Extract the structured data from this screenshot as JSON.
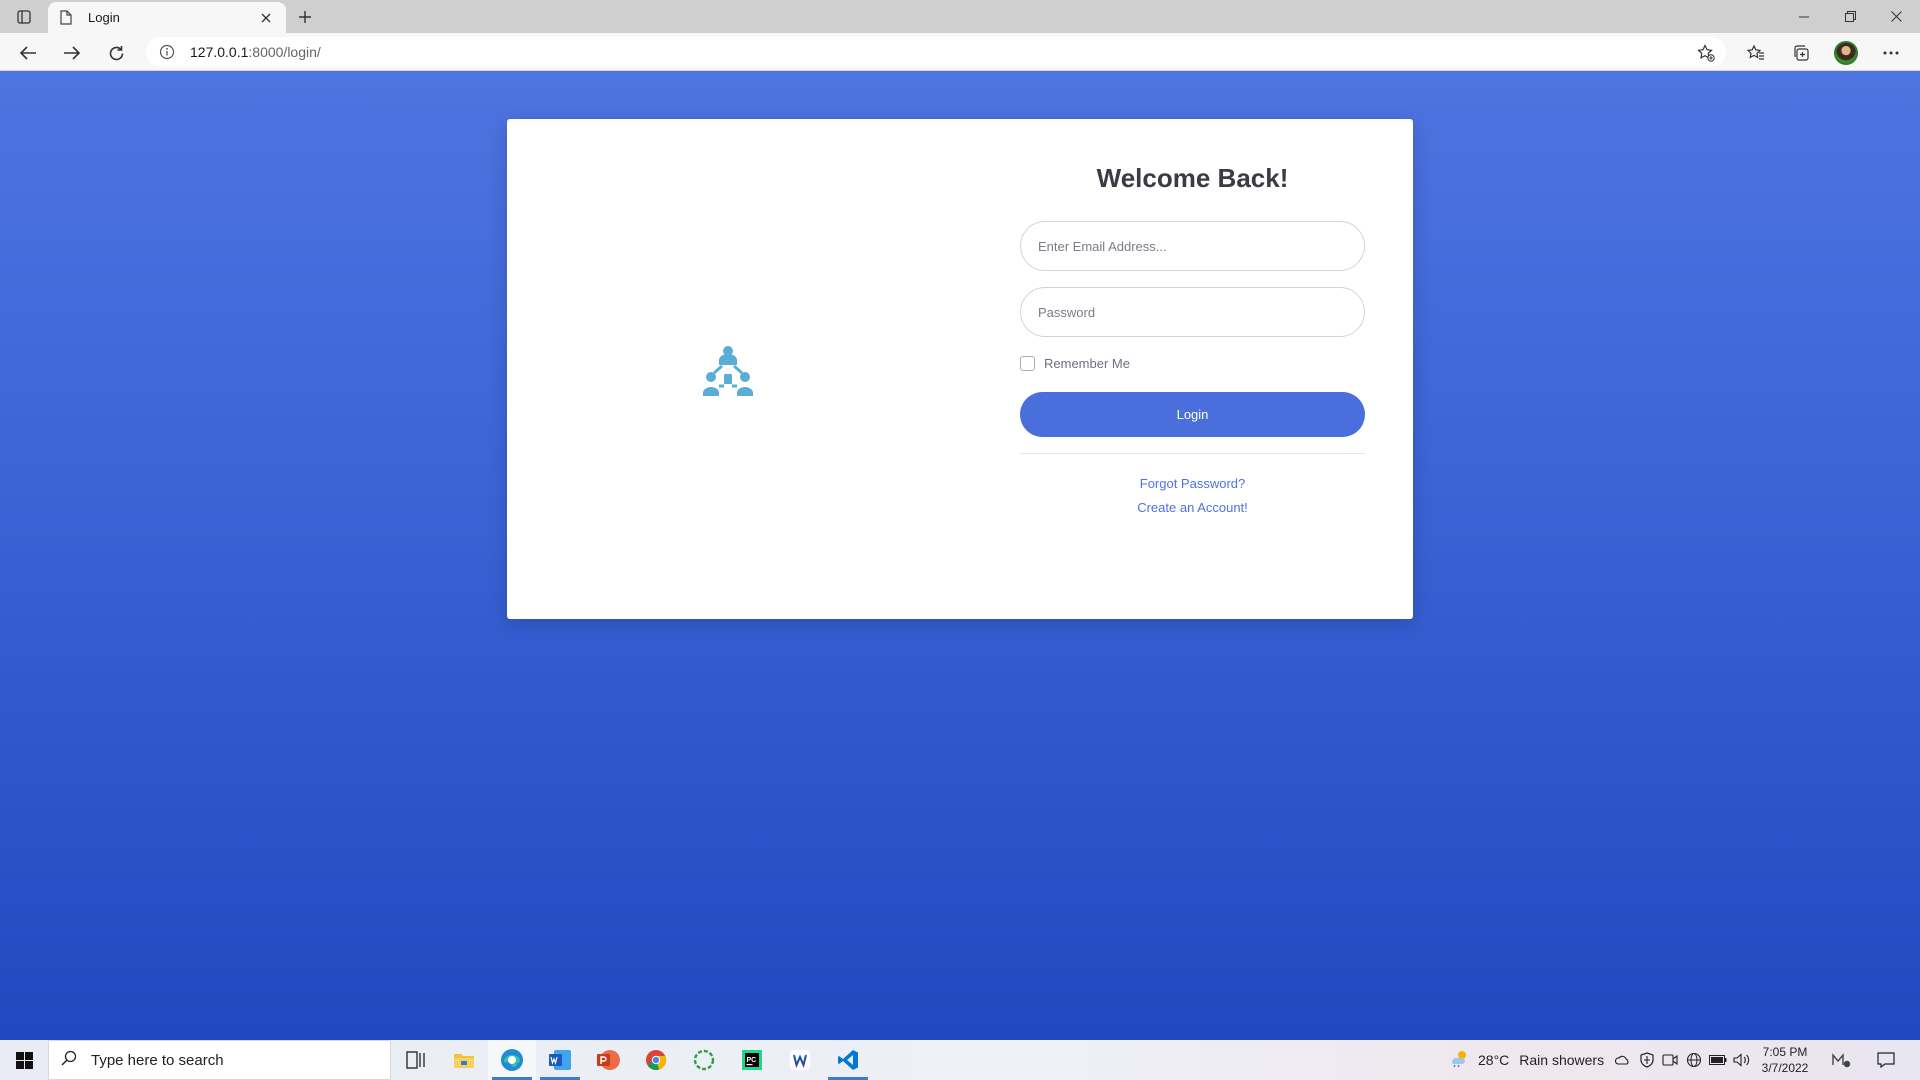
{
  "browser": {
    "tab_title": "Login",
    "url_host": "127.0.0.1",
    "url_rest": ":8000/login/",
    "icons": {
      "tab_actions": "tab-actions-icon",
      "favicon": "page-icon",
      "close": "close-icon",
      "new_tab": "plus-icon",
      "back": "back-arrow-icon",
      "forward": "forward-arrow-icon",
      "refresh": "refresh-icon",
      "site_info": "info-icon",
      "add_favorite": "star-plus-icon",
      "favorites": "favorites-icon",
      "collections": "collections-icon",
      "profile": "avatar",
      "more": "more-icon",
      "minimize": "minimize-icon",
      "restore": "restore-icon",
      "window_close": "close-icon"
    }
  },
  "login": {
    "title": "Welcome Back!",
    "email_placeholder": "Enter Email Address...",
    "password_placeholder": "Password",
    "remember_label": "Remember Me",
    "remember_checked": false,
    "login_button": "Login",
    "forgot_password": "Forgot Password?",
    "create_account": "Create an Account!",
    "accent": "#4a6fdc",
    "logo_color": "#5aaed6",
    "logo_icon": "team-network-icon"
  },
  "taskbar": {
    "search_placeholder": "Type here to search",
    "apps": [
      "task-view-icon",
      "file-explorer-icon",
      "edge-icon",
      "word-icon",
      "powerpoint-icon",
      "chrome-icon",
      "refresh-app-icon",
      "pycharm-icon",
      "app-icon",
      "vscode-icon"
    ],
    "weather_temp": "28°C",
    "weather_condition": "Rain showers",
    "time": "7:05 PM",
    "date": "3/7/2022"
  }
}
